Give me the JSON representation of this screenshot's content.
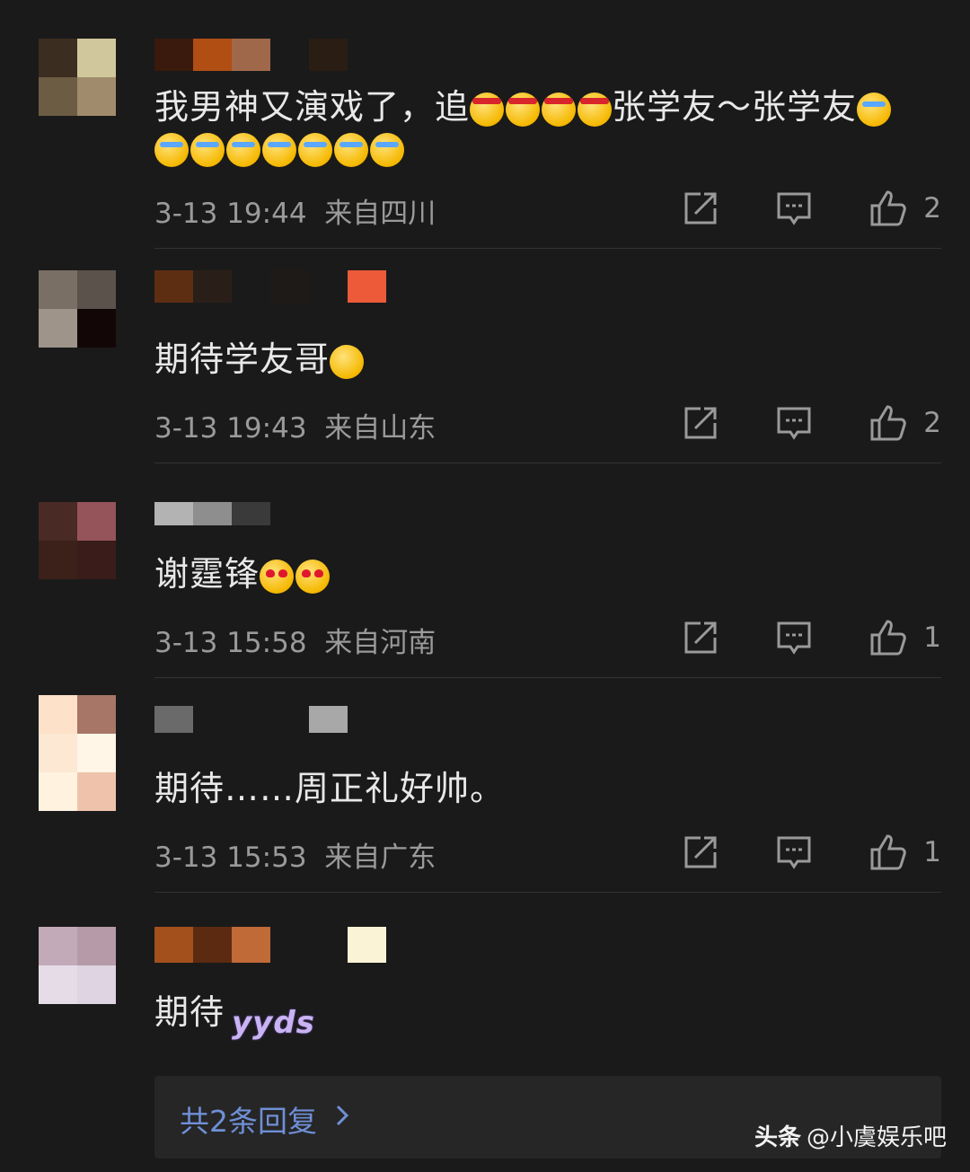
{
  "comments": [
    {
      "text": "我男神又演戏了，追",
      "text_mid": "张学友～张学友",
      "time": "3-13 19:44",
      "location": "来自四川",
      "likes": "2"
    },
    {
      "text": "期待学友哥",
      "time": "3-13 19:43",
      "location": "来自山东",
      "likes": "2"
    },
    {
      "text": "谢霆锋",
      "time": "3-13 15:58",
      "location": "来自河南",
      "likes": "1"
    },
    {
      "text": "期待……周正礼好帅。",
      "time": "3-13 15:53",
      "location": "来自广东",
      "likes": "1"
    },
    {
      "text": "期待",
      "sticker": "yyds"
    }
  ],
  "replies_label": "共2条回复",
  "watermark": {
    "brand": "头条",
    "handle": "@小虞娱乐吧"
  },
  "colors": {
    "background": "#1a1a1a",
    "reply_link": "#6f8fd6"
  },
  "icons": [
    "share-icon",
    "comment-icon",
    "like-icon",
    "chevron-right-icon"
  ]
}
